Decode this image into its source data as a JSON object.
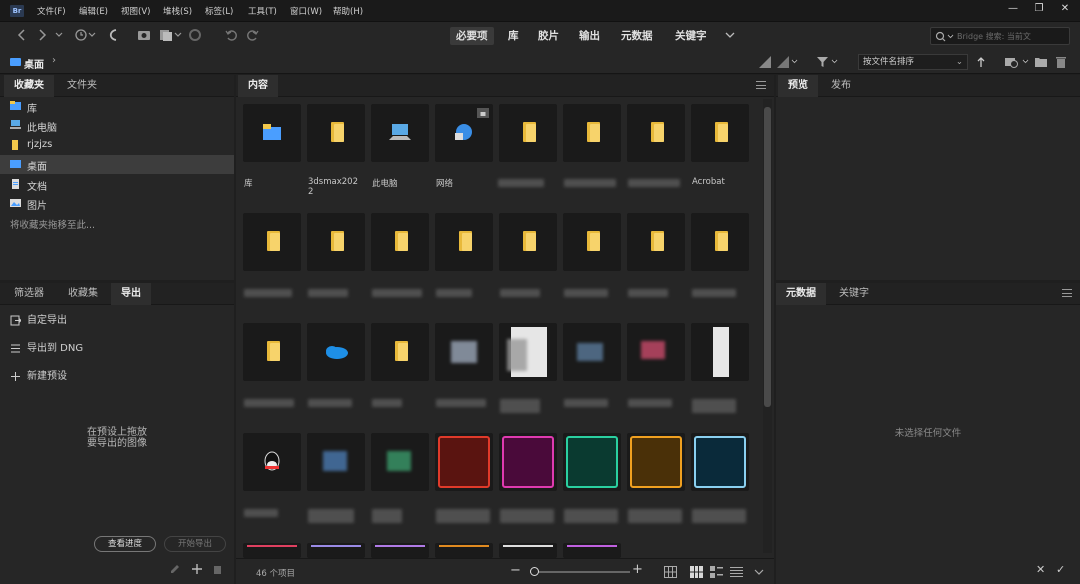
{
  "app": {
    "logo": "Br"
  },
  "menu": [
    "文件(F)",
    "编辑(E)",
    "视图(V)",
    "堆栈(S)",
    "标签(L)",
    "工具(T)",
    "窗口(W)",
    "帮助(H)"
  ],
  "window_controls": {
    "minimize": "—",
    "restore": "❐",
    "close": "✕"
  },
  "workspaces": [
    {
      "label": "必要项",
      "active": true
    },
    {
      "label": "库",
      "active": false
    },
    {
      "label": "胶片",
      "active": false
    },
    {
      "label": "输出",
      "active": false
    },
    {
      "label": "元数据",
      "active": false
    },
    {
      "label": "关键字",
      "active": false
    }
  ],
  "search": {
    "placeholder": "Bridge 搜索: 当前文"
  },
  "path": {
    "current": "桌面"
  },
  "sort": {
    "selected": "按文件名排序"
  },
  "left_top_panel": {
    "tabs": [
      {
        "label": "收藏夹",
        "active": true
      },
      {
        "label": "文件夹",
        "active": false
      }
    ],
    "items": [
      {
        "label": "库",
        "icon": "library-icon",
        "selected": false
      },
      {
        "label": "此电脑",
        "icon": "computer-icon",
        "selected": false
      },
      {
        "label": "rjzjzs",
        "icon": "folder-icon",
        "selected": false
      },
      {
        "label": "桌面",
        "icon": "desktop-icon",
        "selected": true
      },
      {
        "label": "文档",
        "icon": "document-icon",
        "selected": false
      },
      {
        "label": "图片",
        "icon": "pictures-icon",
        "selected": false
      }
    ],
    "hint": "将收藏夹拖移至此..."
  },
  "left_bottom_panel": {
    "tabs": [
      {
        "label": "筛选器",
        "active": false
      },
      {
        "label": "收藏集",
        "active": false
      },
      {
        "label": "导出",
        "active": true
      }
    ],
    "items": [
      {
        "label": "自定导出",
        "icon": "export-icon"
      },
      {
        "label": "导出到 DNG",
        "icon": "list-icon"
      },
      {
        "label": "新建预设",
        "icon": "plus-icon"
      }
    ],
    "drop_hint_line1": "在预设上拖放",
    "drop_hint_line2": "要导出的图像",
    "progress_button": "查看进度",
    "start_button": "开始导出"
  },
  "content": {
    "tab": "内容",
    "row1_captions": [
      "库",
      "3dsmax202\n2",
      "此电脑",
      "网络",
      "",
      "",
      "",
      "Acrobat"
    ],
    "row2_captions": [
      "",
      "",
      "",
      "",
      "",
      "",
      "",
      "",
      "",
      "",
      ""
    ],
    "item_count": "46 个项目"
  },
  "right_top_panel": {
    "tabs": [
      {
        "label": "预览",
        "active": true
      },
      {
        "label": "发布",
        "active": false
      }
    ]
  },
  "right_bottom_panel": {
    "tabs": [
      {
        "label": "元数据",
        "active": true
      },
      {
        "label": "关键字",
        "active": false
      }
    ],
    "empty": "未选择任何文件"
  },
  "colors": {
    "accent": "#4a9eff",
    "folder": "#f7d36b",
    "selection": "#3d3d3d"
  }
}
